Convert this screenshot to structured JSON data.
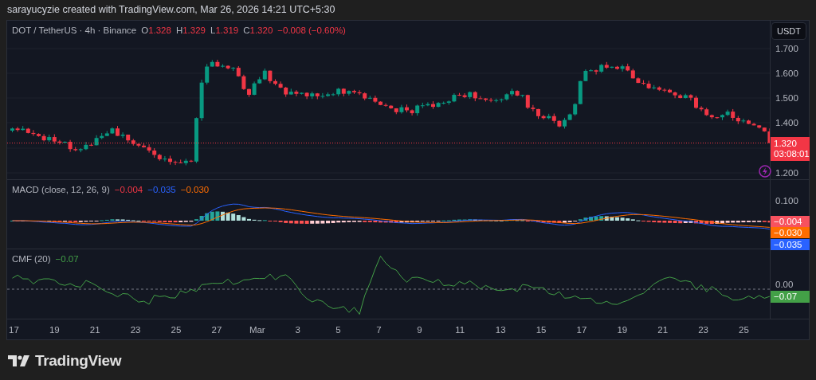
{
  "credit": "sarayucyzie created with TradingView.com, Mar 26, 2026 14:21 UTC+5:30",
  "main_pane": {
    "symbol": "DOT / TetherUS · 4h · Binance",
    "ohlc": [
      {
        "label": "O",
        "value": "1.328"
      },
      {
        "label": "H",
        "value": "1.329"
      },
      {
        "label": "L",
        "value": "1.319"
      },
      {
        "label": "C",
        "value": "1.320"
      }
    ],
    "change": "−0.008 (−0.60%)",
    "currency_button": "USDT",
    "price_ticks": [
      "1.700",
      "1.600",
      "1.500",
      "1.400",
      "1.200"
    ],
    "last_price": "1.320",
    "countdown": "03:08:01"
  },
  "macd_pane": {
    "title": "MACD (close, 12, 26, 9)",
    "values": [
      {
        "value": "−0.004",
        "color": "#f23645"
      },
      {
        "value": "−0.035",
        "color": "#2962ff"
      },
      {
        "value": "−0.030",
        "color": "#ff6d00"
      }
    ],
    "ticks": [
      "0.100"
    ],
    "badges": [
      {
        "value": "−0.004",
        "color": "#f7525f"
      },
      {
        "value": "−0.030",
        "color": "#ff6d00"
      },
      {
        "value": "−0.035",
        "color": "#2962ff"
      }
    ]
  },
  "cmf_pane": {
    "title": "CMF (20)",
    "value": "−0.07",
    "ticks": [
      "0.00"
    ],
    "badge": "−0.07"
  },
  "time_axis": [
    "17",
    "19",
    "21",
    "23",
    "25",
    "27",
    "Mar",
    "3",
    "5",
    "7",
    "9",
    "11",
    "13",
    "15",
    "17",
    "19",
    "21",
    "23",
    "25"
  ],
  "brand": "TradingView"
}
